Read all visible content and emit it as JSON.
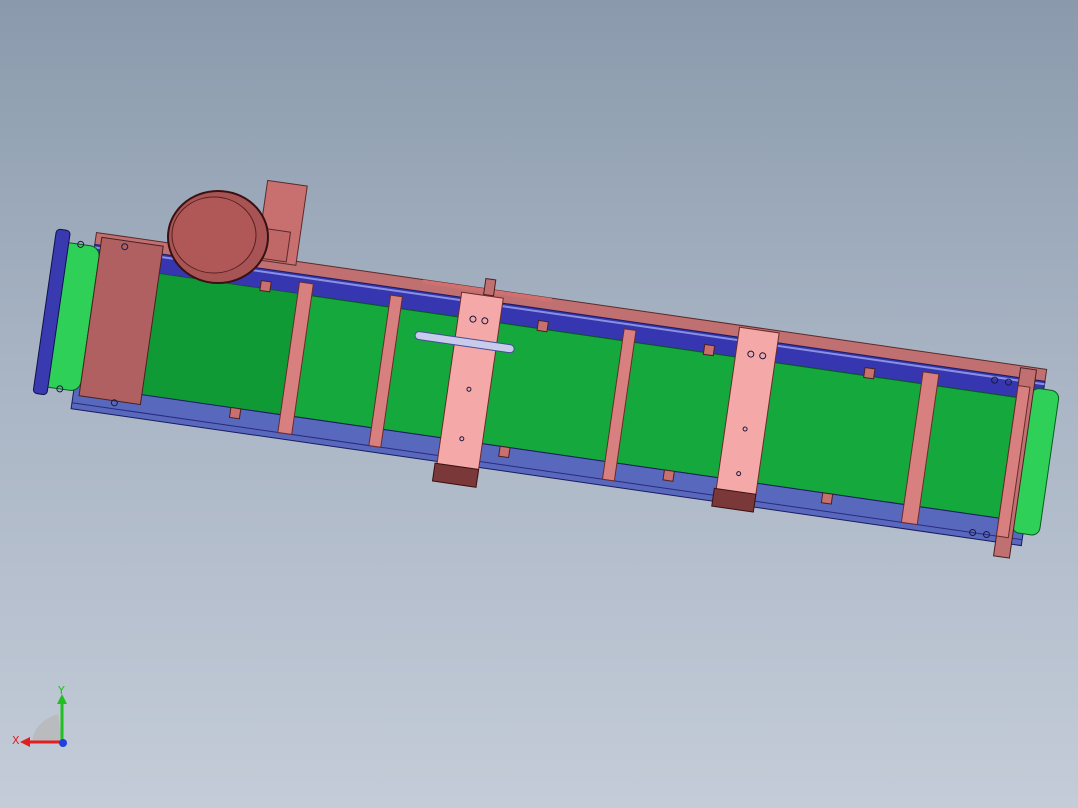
{
  "viewport": {
    "background_top": "#8a9aac",
    "background_bottom": "#c4ccd8",
    "model": {
      "description_icon": "belt-conveyor-model",
      "colors": {
        "belt_green": "#15a83c",
        "belt_green_dark": "#0f8f32",
        "frame_blue": "#3a3ab4",
        "frame_blue_light": "#5a68c0",
        "bracket_salmon": "#c87070",
        "plate_pink": "#f4a0a0",
        "motor_red": "#b05858",
        "roller_green": "#2ecc55"
      }
    }
  },
  "triad": {
    "x_label": "X",
    "y_label": "Y",
    "x_color": "#e02020",
    "y_color": "#20c020",
    "z_color": "#2040e0"
  }
}
